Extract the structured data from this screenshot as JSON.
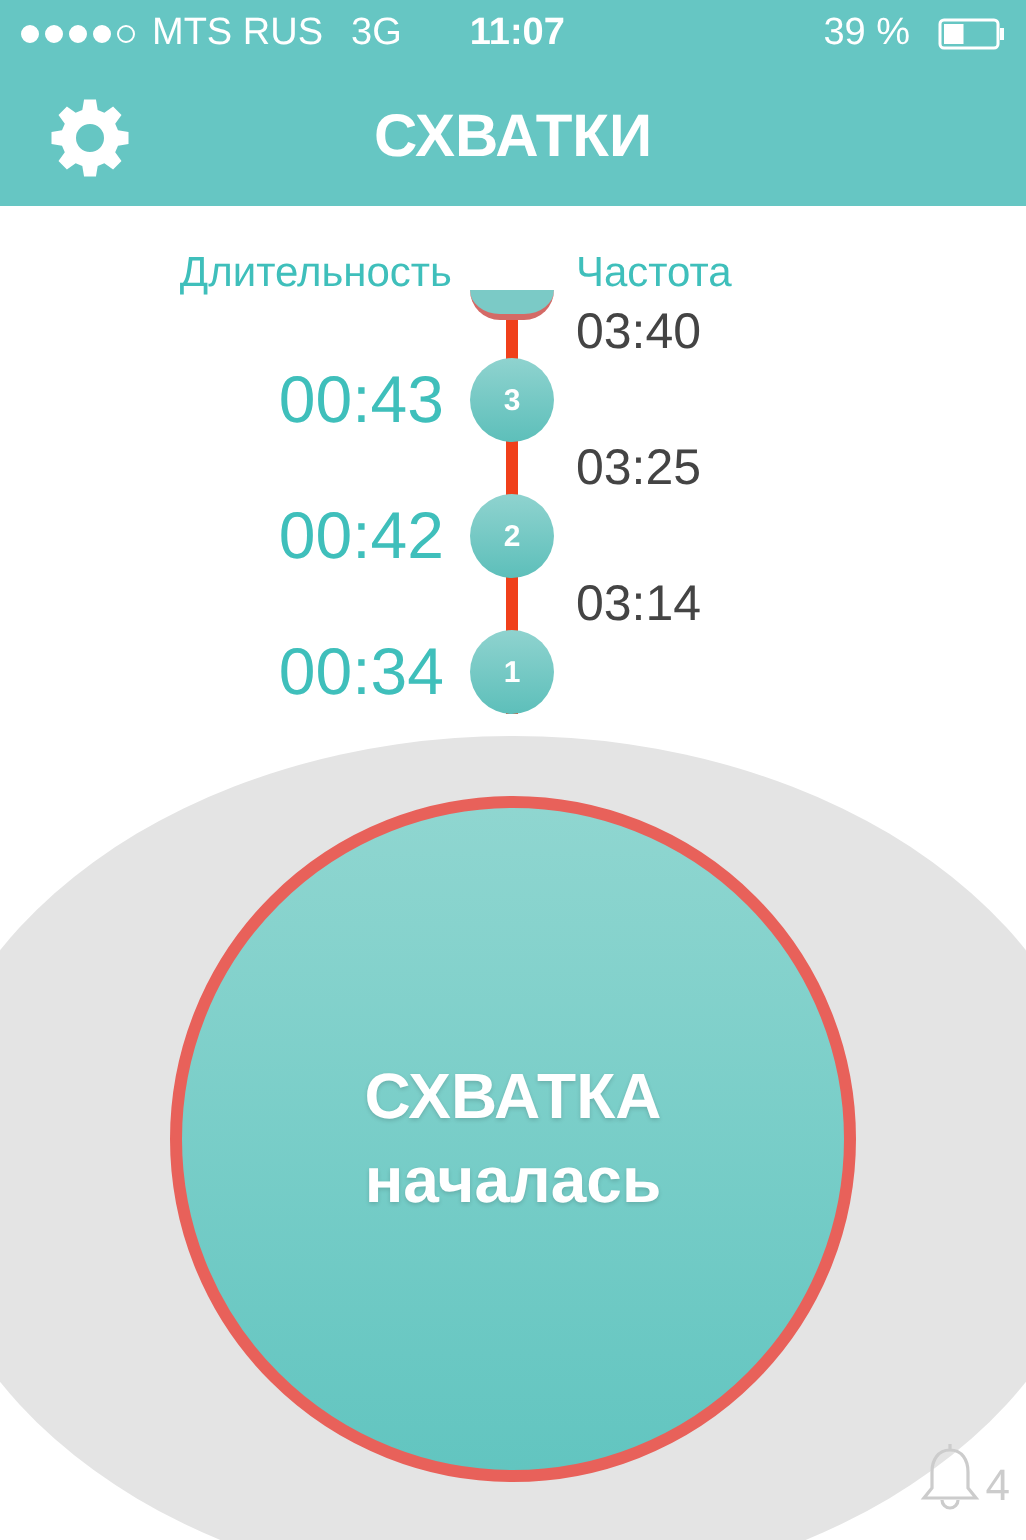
{
  "status_bar": {
    "carrier": "MTS RUS",
    "network": "3G",
    "time": "11:07",
    "battery": "39 %"
  },
  "nav": {
    "title": "СХВАТКИ"
  },
  "columns": [
    "Длительность",
    "Частота"
  ],
  "contractions": [
    {
      "interval": "03:40",
      "duration": "00:43",
      "number": "3"
    },
    {
      "interval": "03:25",
      "duration": "00:42",
      "number": "2"
    },
    {
      "interval": "03:14",
      "duration": "00:34",
      "number": "1"
    }
  ],
  "start_button": {
    "line_1": "СХВАТКА",
    "line_2": "началась"
  },
  "notifications": {
    "count": "4"
  }
}
